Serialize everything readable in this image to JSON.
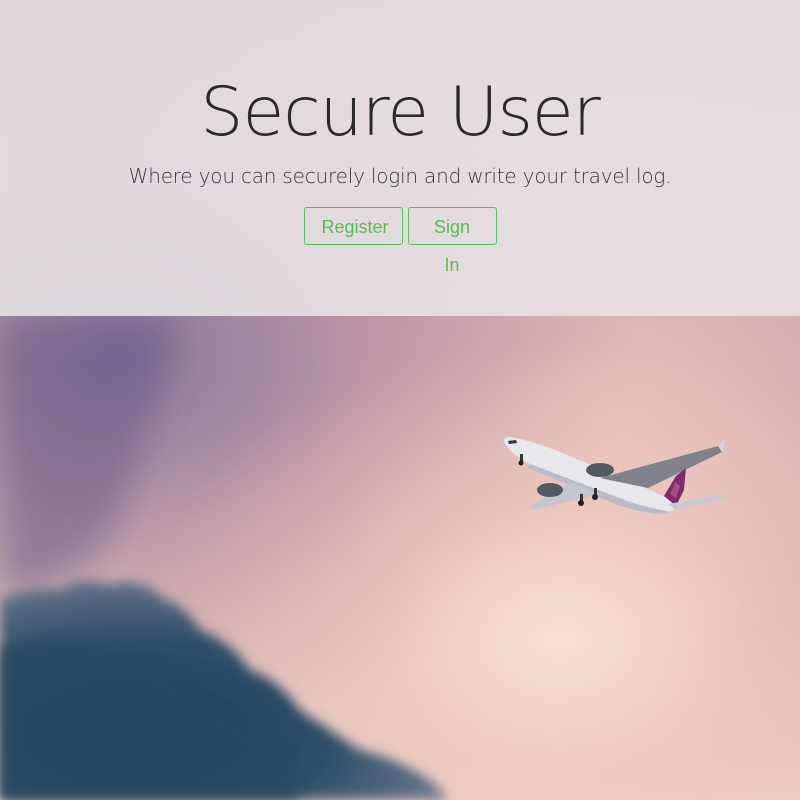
{
  "hero": {
    "title": "Secure User",
    "subtitle": "Where you can securely login and write your travel log.",
    "register_label": "Register",
    "signin_label": "Sign In"
  },
  "colors": {
    "button_accent": "#5cb85c",
    "hero_overlay": "#e8e4e6",
    "title_text": "#2a2a2e"
  },
  "background": {
    "icon": "airplane-in-sky-photo"
  }
}
